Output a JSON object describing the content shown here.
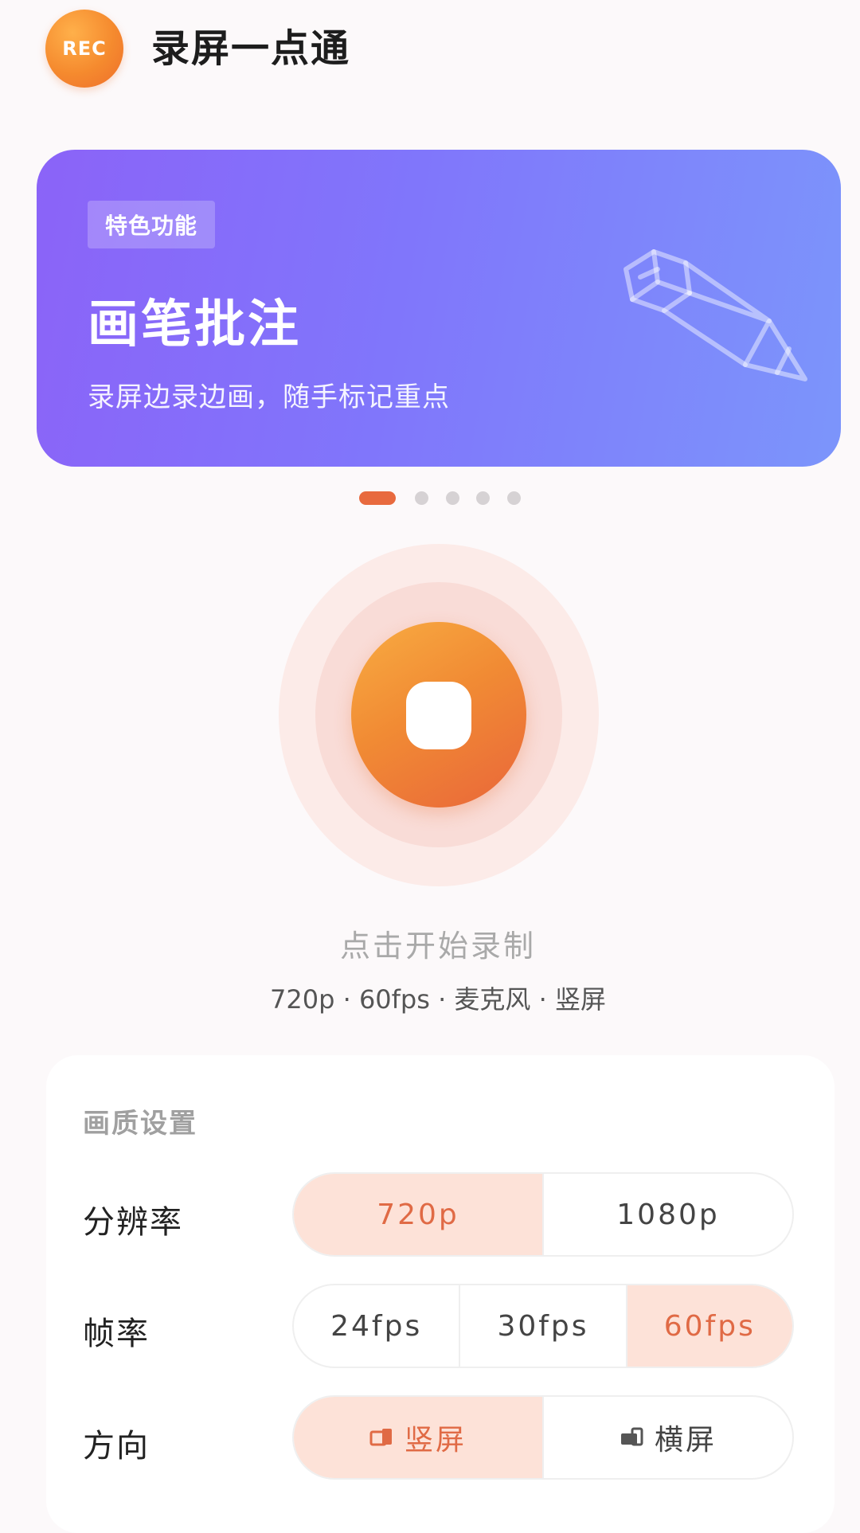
{
  "header": {
    "logo_text": "REC",
    "title": "录屏一点通"
  },
  "banner": {
    "tag": "特色功能",
    "title": "画笔批注",
    "subtitle": "录屏边录边画，随手标记重点",
    "icon": "pencil-icon",
    "gradient": [
      "#8B63F8",
      "#7C95FB"
    ]
  },
  "carousel": {
    "count": 5,
    "active_index": 0
  },
  "record": {
    "hint": "点击开始录制",
    "meta": "720p · 60fps · 麦克风 · 竖屏",
    "icon": "stop-icon",
    "accent": "#EE6E2B"
  },
  "settings": {
    "title": "画质设置",
    "resolution": {
      "label": "分辨率",
      "options": [
        "720p",
        "1080p"
      ],
      "selected": "720p"
    },
    "framerate": {
      "label": "帧率",
      "options": [
        "24fps",
        "30fps",
        "60fps"
      ],
      "selected": "60fps"
    },
    "orientation": {
      "label": "方向",
      "options": [
        "竖屏",
        "横屏"
      ],
      "selected": "竖屏"
    }
  }
}
